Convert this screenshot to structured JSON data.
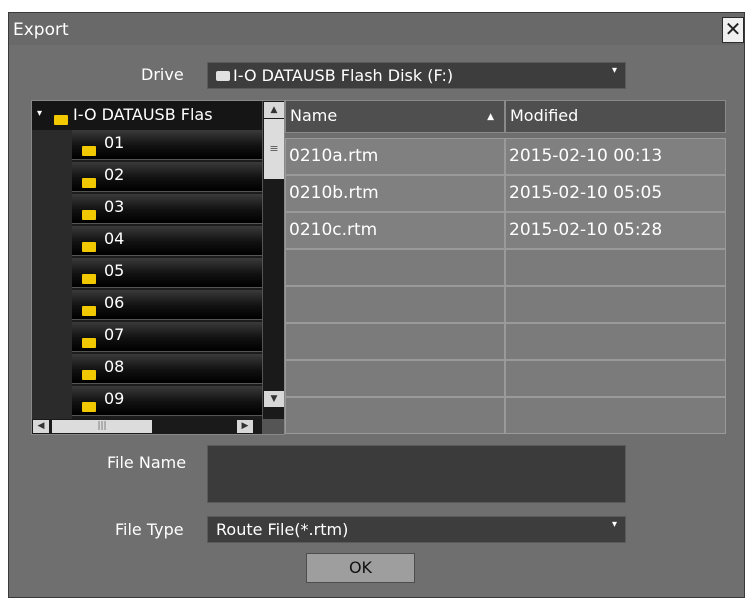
{
  "dialog": {
    "title": "Export",
    "close": "✕"
  },
  "drive": {
    "label": "Drive",
    "value": "I-O DATAUSB Flash Disk (F:)",
    "arrow": "▾"
  },
  "tree": {
    "root": "I-O DATAUSB Flas",
    "expand": "▾",
    "folders": [
      "01",
      "02",
      "03",
      "04",
      "05",
      "06",
      "07",
      "08",
      "09"
    ],
    "scroll_up": "▲",
    "scroll_down": "▼",
    "grip": "≡",
    "scroll_left": "◀",
    "scroll_right": "▶",
    "hgrip": "|||"
  },
  "table": {
    "columns": [
      {
        "label": "Name",
        "sort": "▲"
      },
      {
        "label": "Modified"
      }
    ],
    "rows": [
      {
        "name": "0210a.rtm",
        "modified": "2015-02-10 00:13"
      },
      {
        "name": "0210b.rtm",
        "modified": "2015-02-10 05:05"
      },
      {
        "name": "0210c.rtm",
        "modified": "2015-02-10 05:28"
      }
    ]
  },
  "file_name": {
    "label": "File Name",
    "value": ""
  },
  "file_type": {
    "label": "File Type",
    "value": "Route File(*.rtm)",
    "arrow": "▾"
  },
  "ok_button": "OK"
}
